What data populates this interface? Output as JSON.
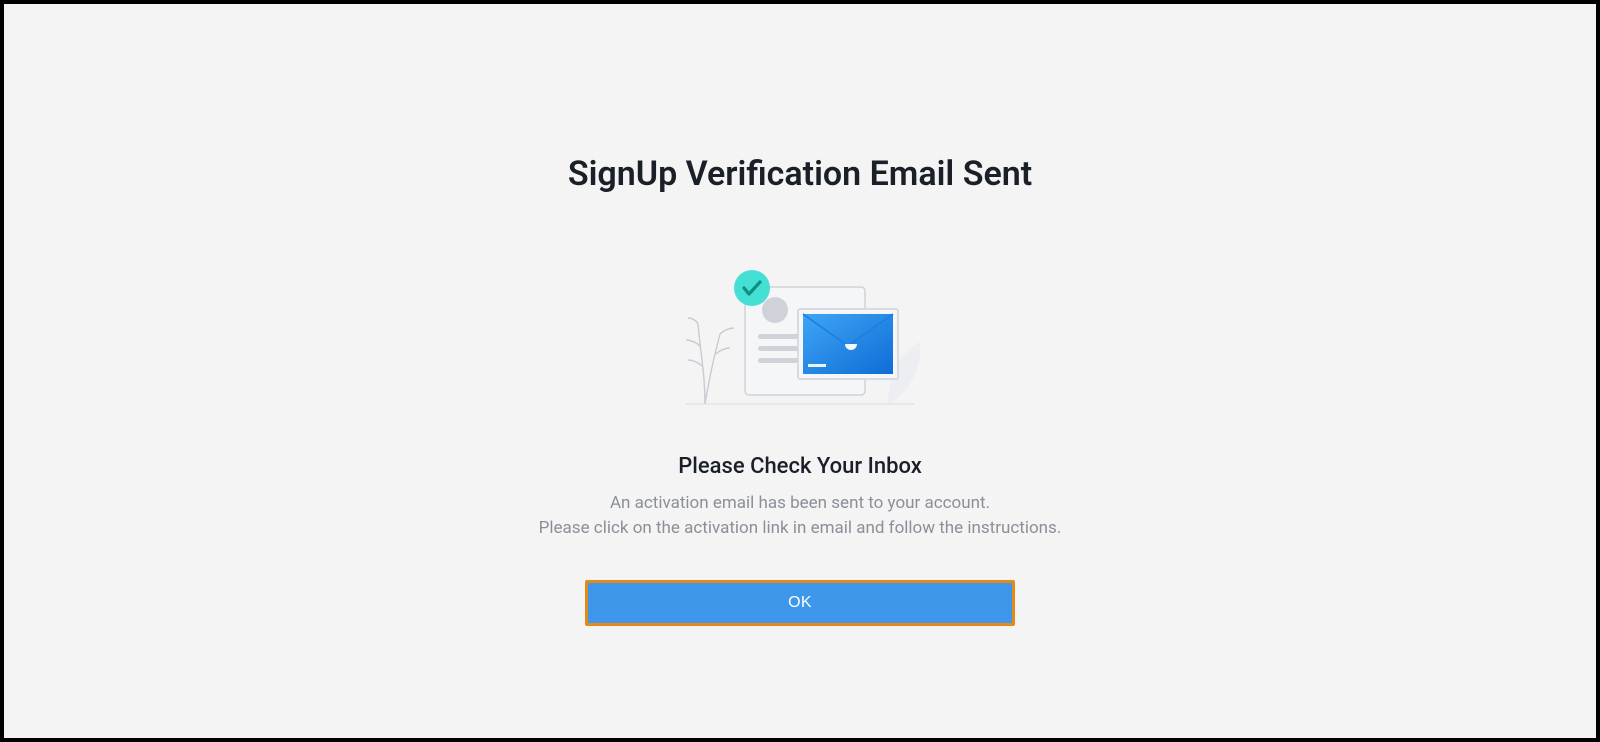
{
  "title": "SignUp Verification Email Sent",
  "subtitle": "Please Check Your Inbox",
  "message_line1": "An activation email has been sent to your account.",
  "message_line2": "Please click on the activation link in email and follow the instructions.",
  "ok_label": "OK"
}
